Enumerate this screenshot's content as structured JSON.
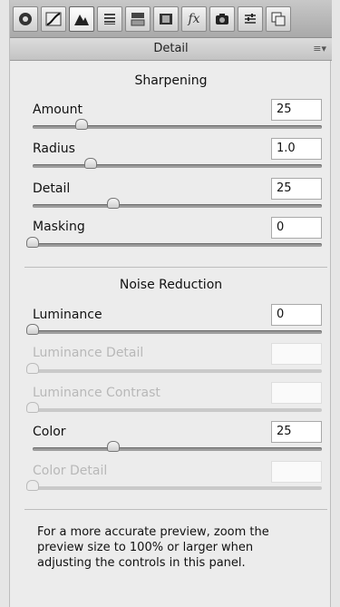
{
  "toolbar": {
    "icons": [
      "basic-icon",
      "tone-curve-icon",
      "detail-icon",
      "hsl-icon",
      "split-toning-icon",
      "lens-corrections-icon",
      "effects-icon",
      "camera-calibration-icon",
      "presets-icon",
      "snapshots-icon"
    ],
    "fx_label": "fx"
  },
  "panel": {
    "title": "Detail"
  },
  "sharpening": {
    "title": "Sharpening",
    "amount": {
      "label": "Amount",
      "value": "25",
      "position": 0.17
    },
    "radius": {
      "label": "Radius",
      "value": "1.0",
      "position": 0.2
    },
    "detail": {
      "label": "Detail",
      "value": "25",
      "position": 0.28
    },
    "masking": {
      "label": "Masking",
      "value": "0",
      "position": 0.0
    }
  },
  "noise": {
    "title": "Noise Reduction",
    "luminance": {
      "label": "Luminance",
      "value": "0",
      "position": 0.0
    },
    "luminance_detail": {
      "label": "Luminance Detail",
      "value": "",
      "position": 0.0
    },
    "luminance_contrast": {
      "label": "Luminance Contrast",
      "value": "",
      "position": 0.0
    },
    "color": {
      "label": "Color",
      "value": "25",
      "position": 0.28
    },
    "color_detail": {
      "label": "Color Detail",
      "value": "",
      "position": 0.0
    }
  },
  "note": "For a more accurate preview, zoom the preview size to 100% or larger when adjusting the controls in this panel."
}
